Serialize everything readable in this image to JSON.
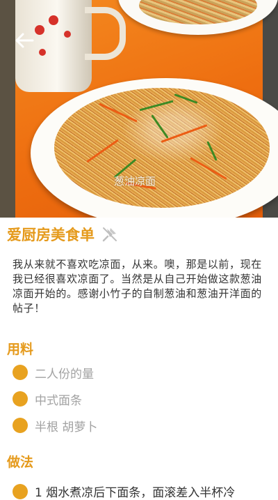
{
  "recipe": {
    "photo_watermark": "葱油凉面",
    "title": "爱厨房美食单",
    "intro": "我从来就不喜欢吃凉面，从来。噢，那是以前，现在我已经很喜欢凉面了。当然是从自己开始做这款葱油凉面开始的。感谢小竹子的自制葱油和葱油开洋面的帖子！"
  },
  "ingredients": {
    "heading": "用料",
    "items": [
      {
        "label": "二人份的量"
      },
      {
        "label": "中式面条"
      },
      {
        "label": "半根 胡萝卜"
      }
    ]
  },
  "method": {
    "heading": "做法",
    "steps": [
      {
        "text": "1 烟水煮凉后下面条，面滚差入半杯冷"
      }
    ]
  },
  "colors": {
    "accent": "#e59a1c",
    "bullet": "#e8a220",
    "muted_text": "#a2a2a2"
  },
  "icons": {
    "back": "arrow-left",
    "favorite": "pin-off"
  }
}
